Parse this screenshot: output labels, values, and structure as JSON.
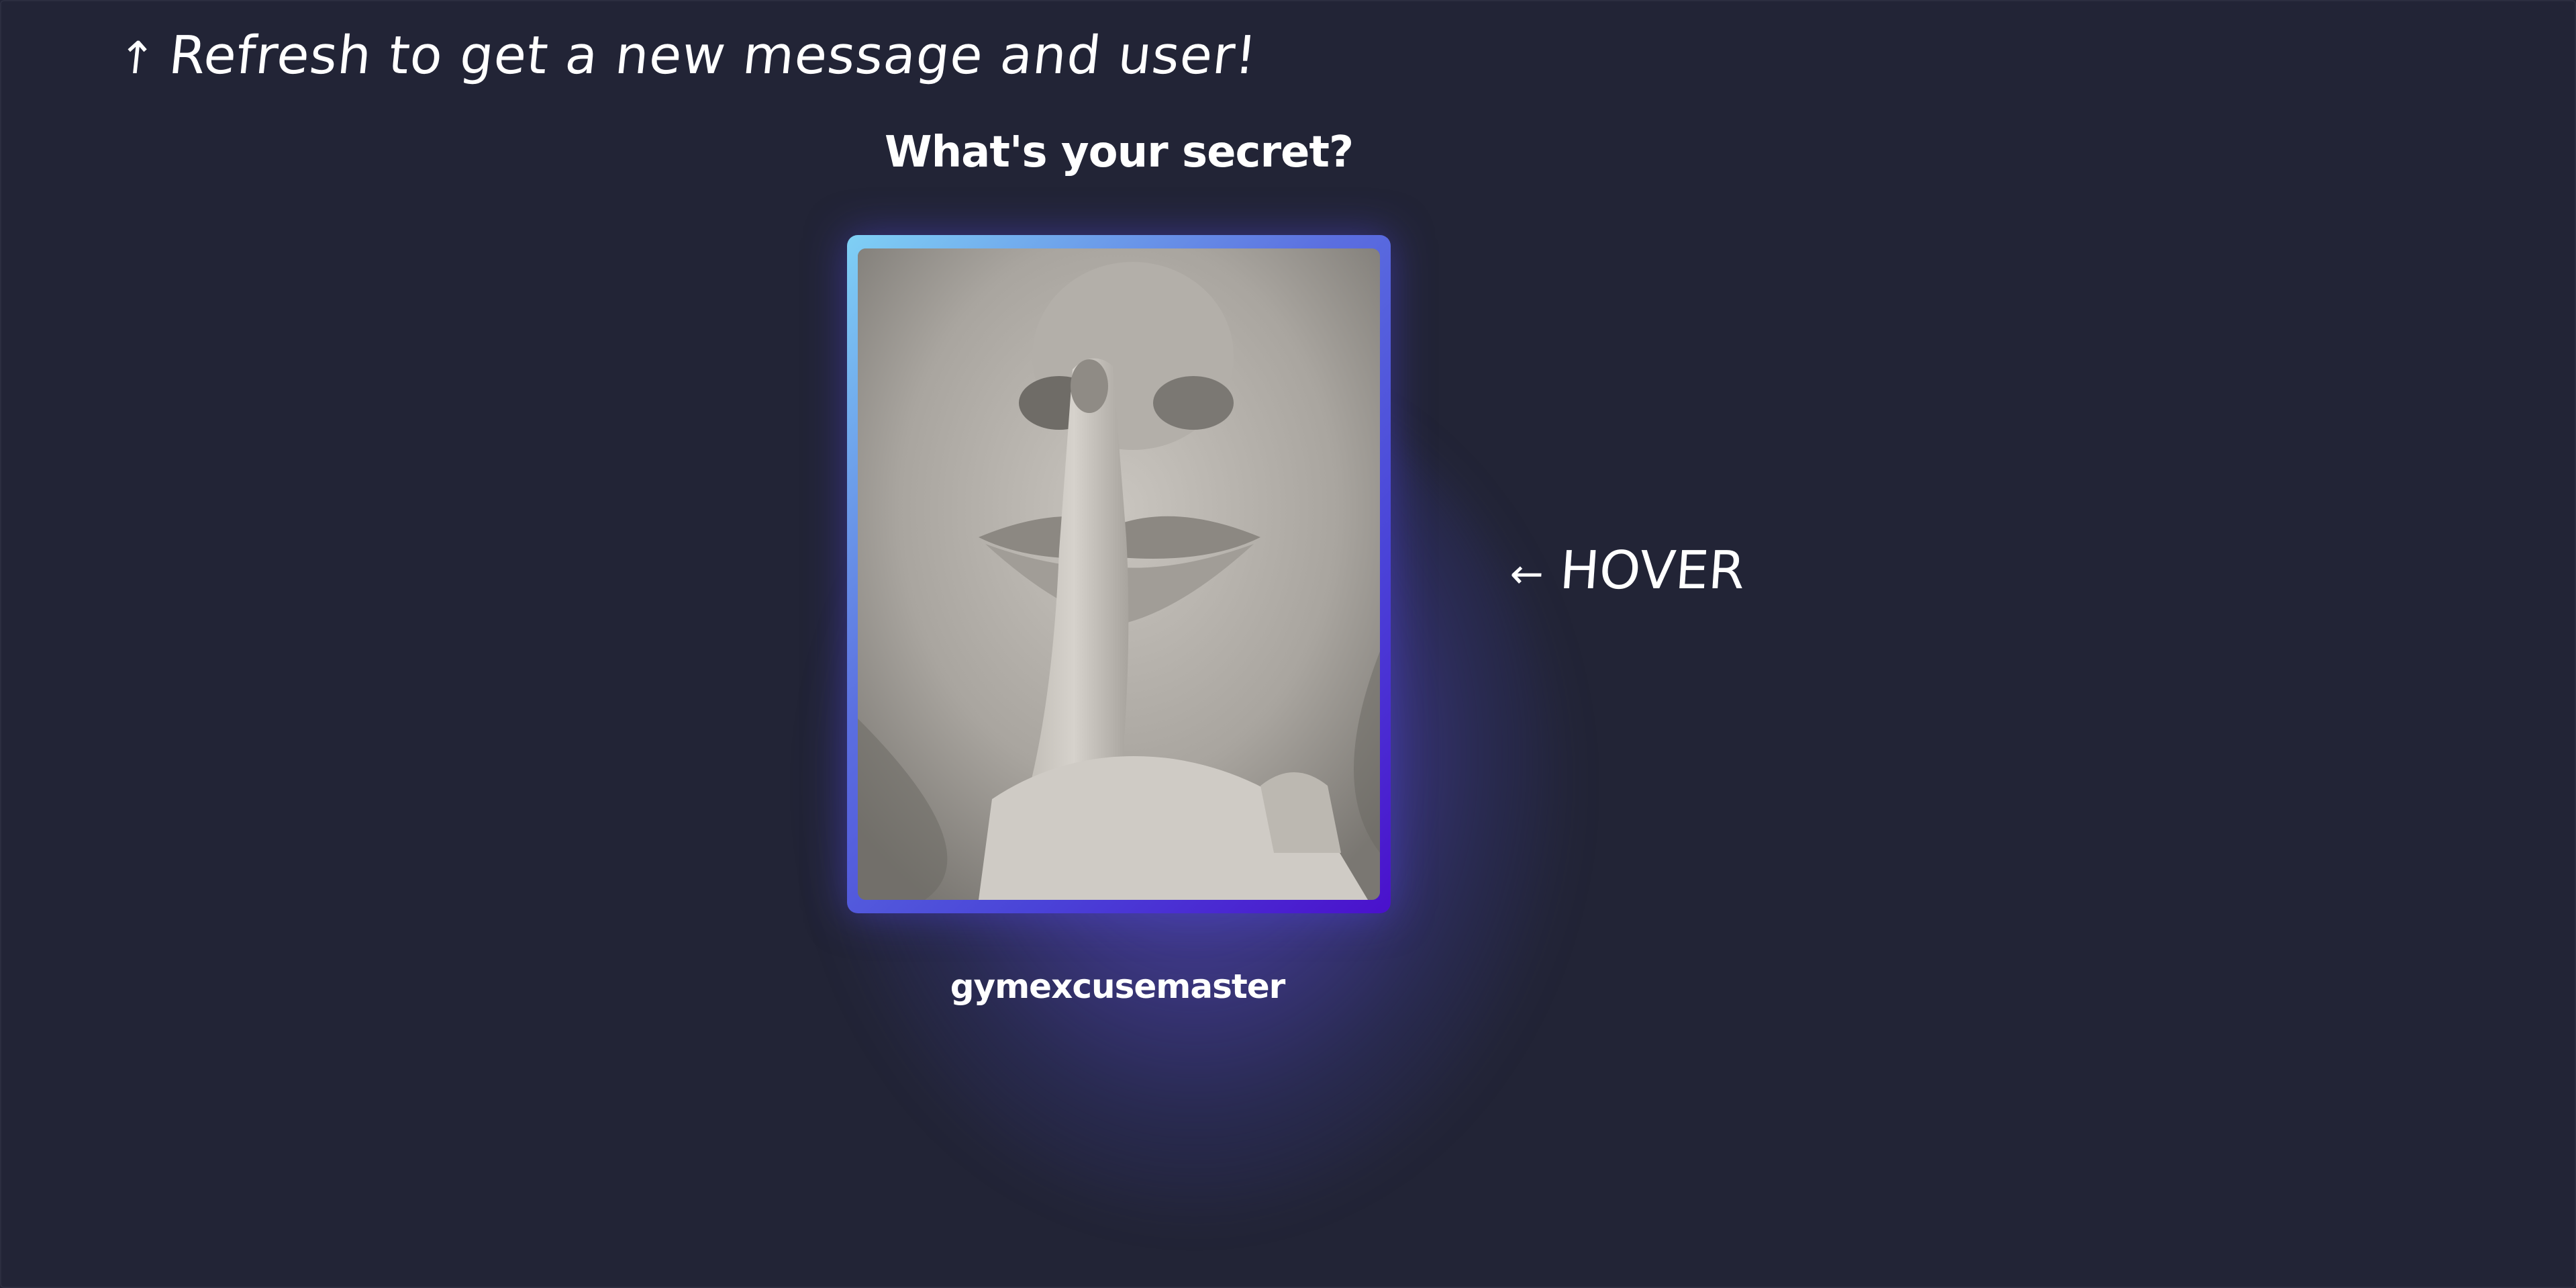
{
  "hints": {
    "refresh_arrow": "↑",
    "refresh_text": "Refresh to get a new message and user!",
    "hover_arrow": "←",
    "hover_text": "HOVER"
  },
  "card": {
    "title": "What's your secret?",
    "image_icon": "shush-finger-on-lips-photo",
    "username": "gymexcusemaster"
  },
  "colors": {
    "background": "#222436",
    "card_gradient_start": "#7fd0f5",
    "card_gradient_end": "#4a10cc",
    "glow": "#5c50dc",
    "text": "#ffffff"
  }
}
